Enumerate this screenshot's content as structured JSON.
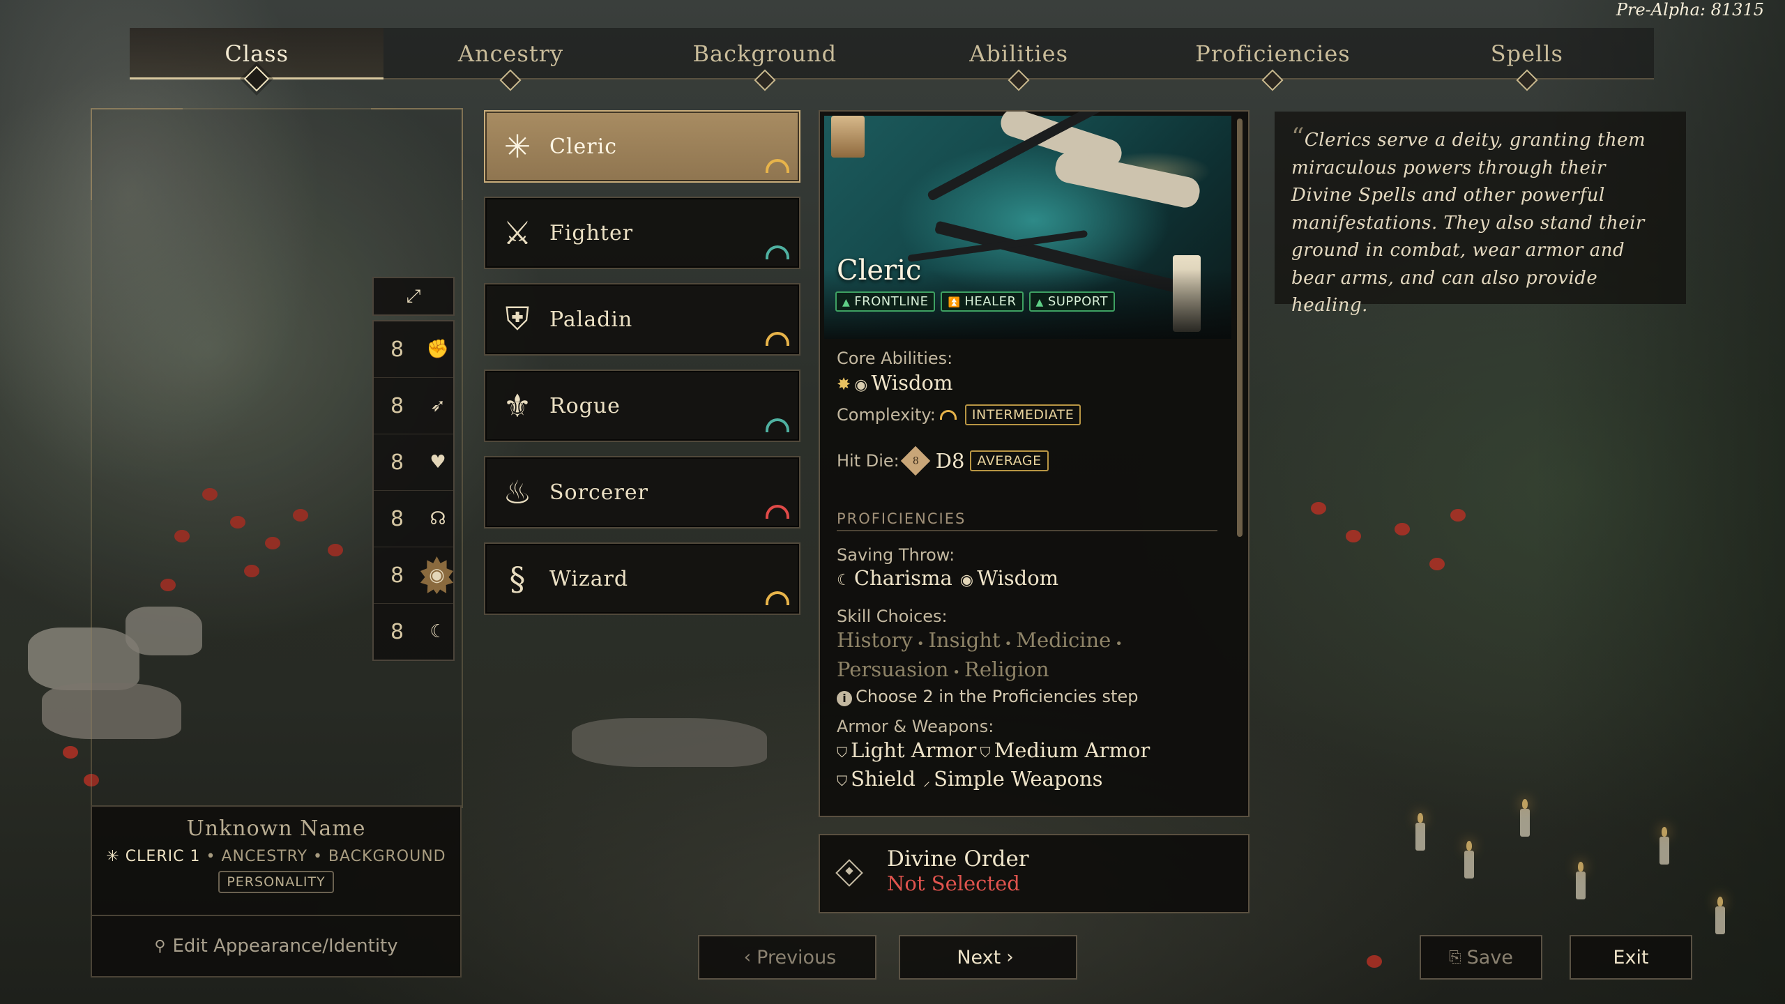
{
  "version": "Pre-Alpha: 81315",
  "tabs": [
    {
      "label": "Class"
    },
    {
      "label": "Ancestry"
    },
    {
      "label": "Background"
    },
    {
      "label": "Abilities"
    },
    {
      "label": "Proficiencies"
    },
    {
      "label": "Spells"
    }
  ],
  "abilities": {
    "expand_icon": "expand-icon",
    "scores": [
      {
        "value": "8",
        "icon": "strength-icon"
      },
      {
        "value": "8",
        "icon": "dexterity-icon"
      },
      {
        "value": "8",
        "icon": "constitution-icon"
      },
      {
        "value": "8",
        "icon": "intelligence-icon"
      },
      {
        "value": "8",
        "icon": "wisdom-icon"
      },
      {
        "value": "8",
        "icon": "charisma-icon"
      }
    ]
  },
  "character": {
    "name": "Unknown Name",
    "class_level": "CLERIC 1",
    "ancestry": "ANCESTRY",
    "background": "BACKGROUND",
    "personality": "PERSONALITY",
    "edit_label": "Edit Appearance/Identity"
  },
  "classes": [
    {
      "label": "Cleric",
      "complexity": "intermediate",
      "selected": true
    },
    {
      "label": "Fighter",
      "complexity": "easy",
      "selected": false
    },
    {
      "label": "Paladin",
      "complexity": "intermediate",
      "selected": false
    },
    {
      "label": "Rogue",
      "complexity": "easy",
      "selected": false
    },
    {
      "label": "Sorcerer",
      "complexity": "hard",
      "selected": false
    },
    {
      "label": "Wizard",
      "complexity": "intermediate",
      "selected": false
    }
  ],
  "detail": {
    "title": "Cleric",
    "tags": [
      "FRONTLINE",
      "HEALER",
      "SUPPORT"
    ],
    "core_abilities_label": "Core Abilities:",
    "core_ability": "Wisdom",
    "complexity_label": "Complexity:",
    "complexity_value": "INTERMEDIATE",
    "hit_die_label": "Hit Die:",
    "hit_die_icon_number": "8",
    "hit_die_value": "D8",
    "hit_die_badge": "AVERAGE",
    "proficiencies_heading": "PROFICIENCIES",
    "saving_throw_label": "Saving Throw:",
    "saving_throws": [
      "Charisma",
      "Wisdom"
    ],
    "skill_choices_label": "Skill Choices:",
    "skills": [
      "History",
      "Insight",
      "Medicine",
      "Persuasion",
      "Religion"
    ],
    "skill_note": "Choose 2 in the Proficiencies step",
    "armor_label": "Armor & Weapons:",
    "armor": [
      "Light Armor",
      "Medium Armor",
      "Shield",
      "Simple Weapons"
    ]
  },
  "divine_order": {
    "title": "Divine Order",
    "status": "Not Selected"
  },
  "description": "Clerics serve a deity, granting them miraculous powers through their Divine Spells and other powerful manifestations. They also stand their ground in combat, wear armor and bear arms, and can also provide healing.",
  "buttons": {
    "previous": "Previous",
    "next": "Next",
    "save": "Save",
    "exit": "Exit"
  },
  "colors": {
    "accent_gold": "#a88c62",
    "tag_green": "#3ea162",
    "status_red": "#e0544e",
    "complexity_intermediate": "#e8b44a",
    "complexity_easy": "#4fb0a0",
    "complexity_hard": "#e04a48"
  }
}
